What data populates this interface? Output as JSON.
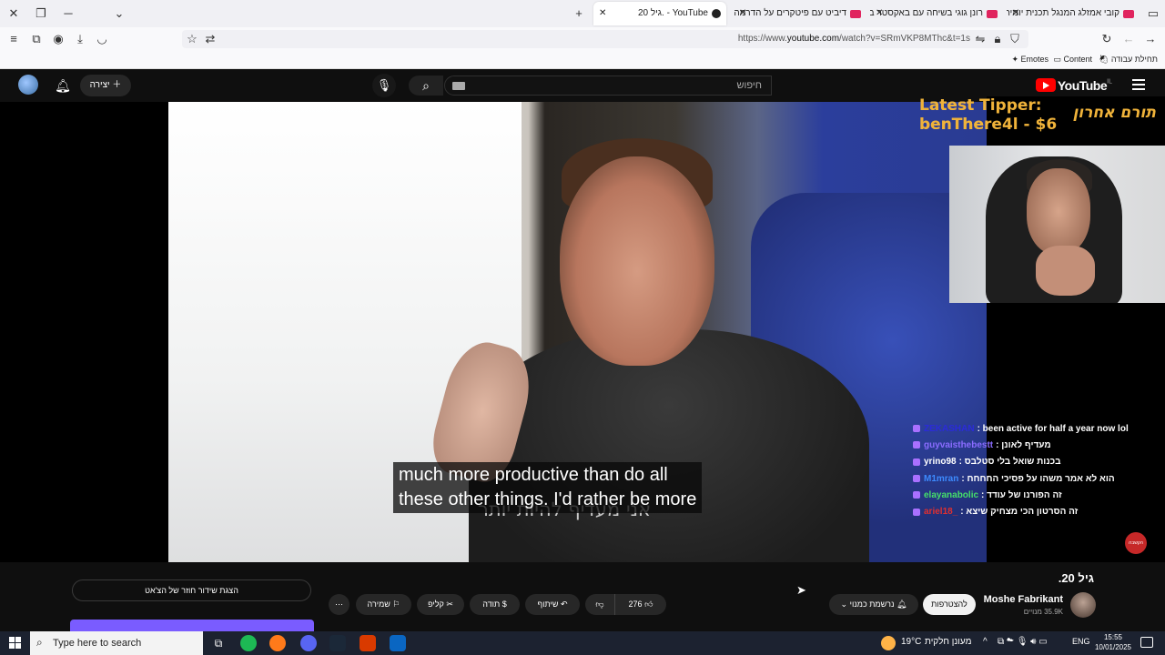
{
  "browser": {
    "tabs": [
      {
        "label": "קובי אמזלג המנגל תכנית יומית כ"
      },
      {
        "label": "רונן גוגי בשיחה עם באקסטר בלו"
      },
      {
        "label": "דיביט עם פיטקרים על הדרמה, כ"
      },
      {
        "label": "גיל 20. - YouTube"
      }
    ],
    "url_prefix": "https://www.",
    "url_domain": "youtube.com",
    "url_rest": "/watch?v=SRmVKP8MThc&t=1s",
    "bookmarks": [
      "תחילת עבודה",
      "Content",
      "Emotes"
    ]
  },
  "youtube": {
    "logo": "YouTube",
    "logo_region": "IL",
    "search_placeholder": "חיפוש",
    "create_label": "יצירה"
  },
  "video": {
    "subtitle_line1": "much more productive than do all",
    "subtitle_line2": "these other things. I'd rather be more",
    "burned_sub": "אני מעדיף להיות יותר",
    "tipper_en_1": "Latest Tipper:",
    "tipper_en_2": "benThere4l - $6",
    "tipper_he": "תורם אחרון",
    "live_badge": "הקשבה"
  },
  "chat": [
    {
      "user": "ZEKASHAN",
      "message": "been active for half a year now lol",
      "color": "#2b2bd9"
    },
    {
      "user": "guyvaisthebestt",
      "message": "מעדיף לאונן",
      "color": "#8a6cff"
    },
    {
      "user": "yrino98",
      "message": "בכנות שואל בלי סטלבס",
      "color": "#ffffff"
    },
    {
      "user": "M1mran",
      "message": "הוא לא אמר משהו על פסיכי החחחח",
      "color": "#3d8bff"
    },
    {
      "user": "elayanabolic",
      "message": "זה הפורנו של עודד",
      "color": "#46e06a"
    },
    {
      "user": "ariel18_",
      "message": "זה הסרטון הכי מצחיק שיצא",
      "color": "#e03030"
    }
  ],
  "meta": {
    "title": "גיל 20.",
    "channel": "Moshe Fabrikant",
    "subscribers": "35.9K מנויים",
    "join_label": "להצטרפות",
    "subscribed_label": "נרשמת כמנוי",
    "likes": "276",
    "share_label": "שיתוף",
    "thanks_label": "תודה",
    "clip_label": "קליפ",
    "save_label": "שמירה",
    "more_label": "⋯",
    "chat_replay": "הצגת שידור חוזר של הצ'אט"
  },
  "taskbar": {
    "search_placeholder": "Type here to search",
    "weather": "19°C",
    "weather_desc": "מעונן חלקית",
    "lang": "ENG",
    "time": "15:55",
    "date": "10/01/2025"
  },
  "colors": {
    "tipper": "#f0b33a",
    "youtube_red": "#ff0000",
    "twitch_purple": "#a970ff"
  }
}
